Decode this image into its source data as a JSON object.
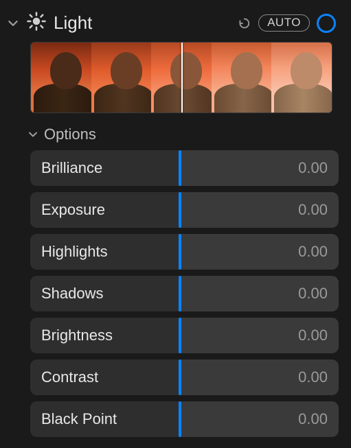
{
  "header": {
    "title": "Light",
    "auto_label": "AUTO"
  },
  "options": {
    "label": "Options"
  },
  "sliders": [
    {
      "label": "Brilliance",
      "value": "0.00"
    },
    {
      "label": "Exposure",
      "value": "0.00"
    },
    {
      "label": "Highlights",
      "value": "0.00"
    },
    {
      "label": "Shadows",
      "value": "0.00"
    },
    {
      "label": "Brightness",
      "value": "0.00"
    },
    {
      "label": "Contrast",
      "value": "0.00"
    },
    {
      "label": "Black Point",
      "value": "0.00"
    }
  ],
  "preview": {
    "thumbs": [
      {
        "sky": "linear-gradient(180deg,#7a2a12 0%,#ca4a22 40%,#e07040 70%)",
        "skin": "#4a2a18",
        "shirt": "linear-gradient(90deg,#2c1a0e,#3b2614,#2c1a0e)"
      },
      {
        "sky": "linear-gradient(180deg,#9a3a1b 0%,#e05c2c 40%,#f07a4a 70%)",
        "skin": "#6a3e25",
        "shirt": "linear-gradient(90deg,#3b2614,#513520,#3b2614)"
      },
      {
        "sky": "linear-gradient(180deg,#b64a24 0%,#ee6b3d 38%,#f69068 70%)",
        "skin": "#8a563a",
        "shirt": "linear-gradient(90deg,#513520,#6a4a32,#513520)"
      },
      {
        "sky": "linear-gradient(180deg,#c85a30 0%,#f3845a 35%,#f7ab8a 70%)",
        "skin": "#a4704f",
        "shirt": "linear-gradient(90deg,#6a4a32,#866549,#6a4a32)"
      },
      {
        "sky": "linear-gradient(180deg,#d5704a 0%,#f6a07c 35%,#fac1a9 70%)",
        "skin": "#bd8a6a",
        "shirt": "linear-gradient(90deg,#866549,#a78564,#866549)"
      }
    ]
  },
  "colors": {
    "accent": "#0a84ff"
  }
}
